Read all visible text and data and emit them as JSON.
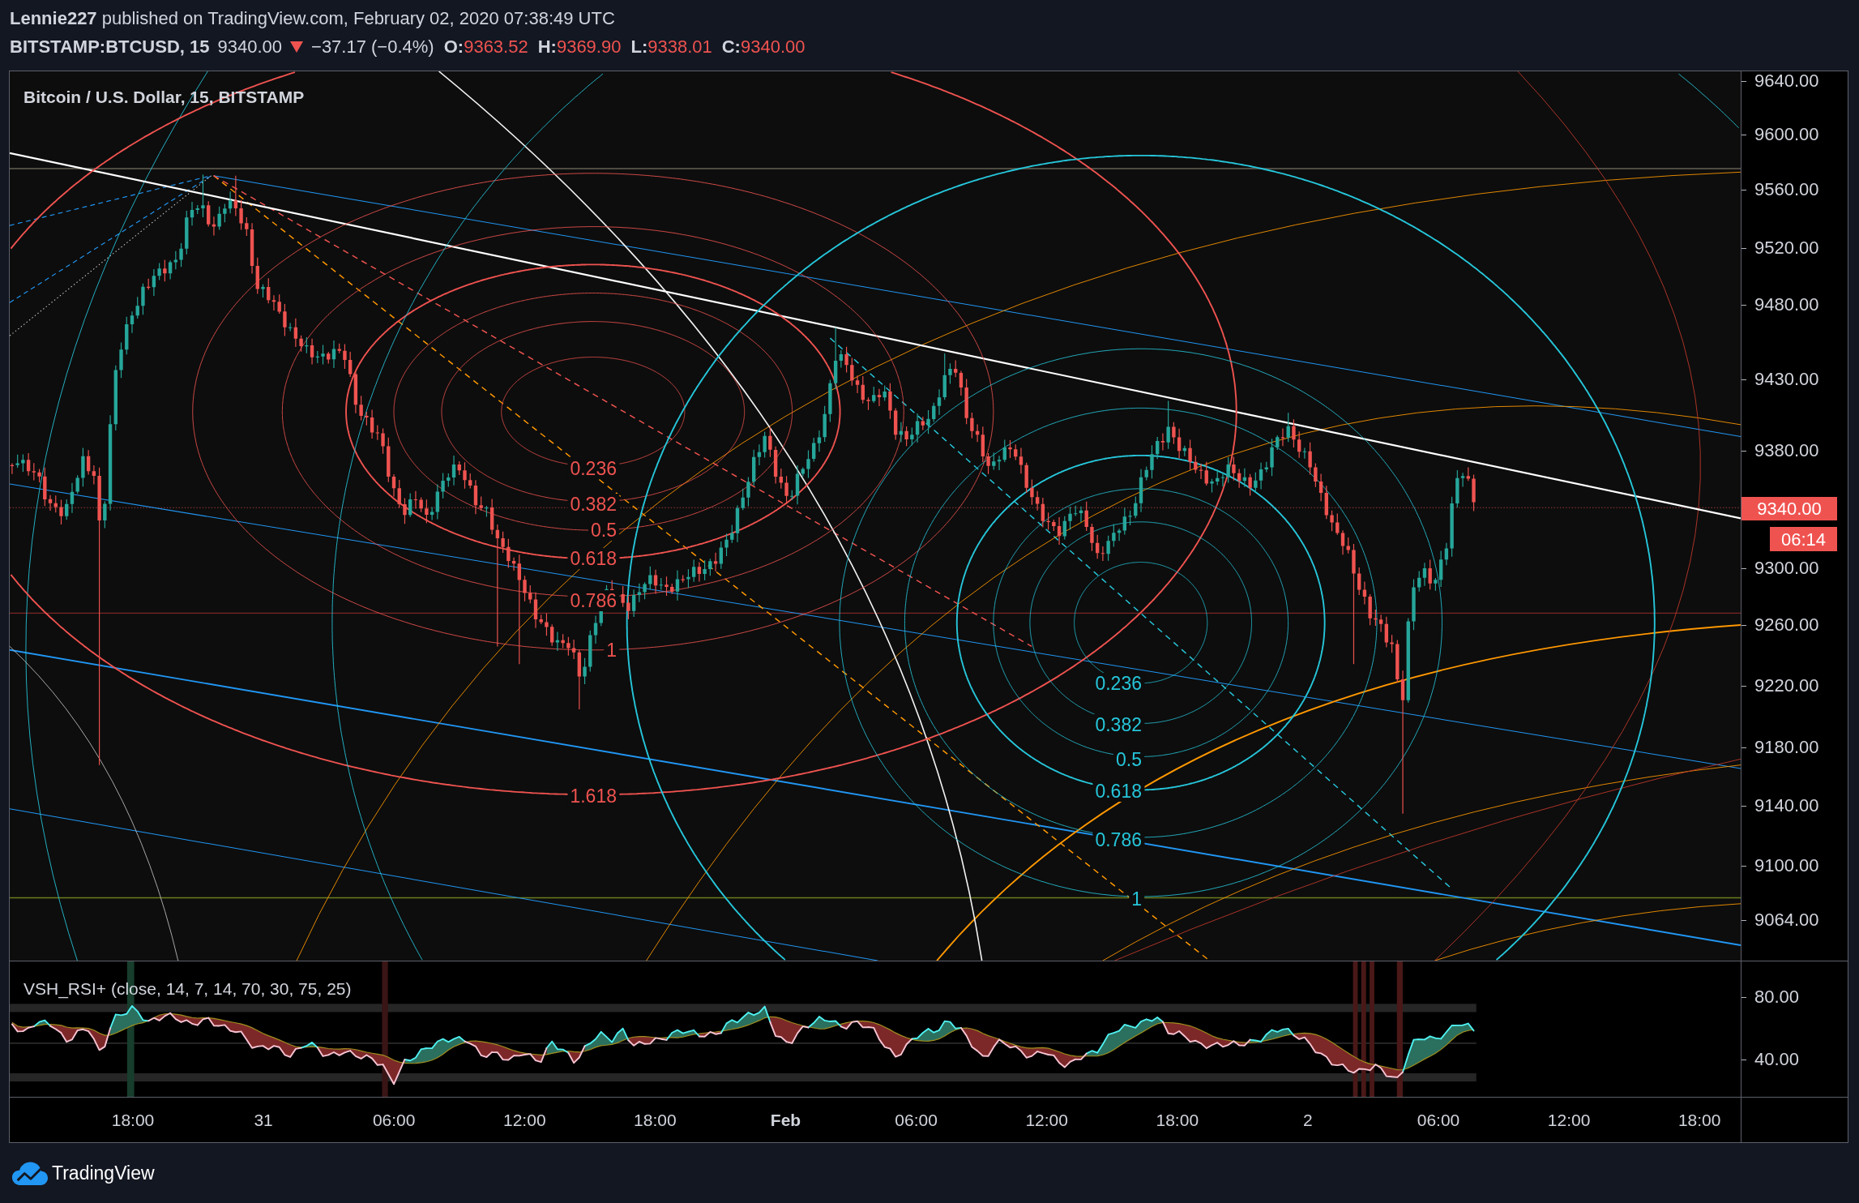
{
  "header": {
    "byline": "**Lennie227** published on TradingView.com, February 02, 2020 07:38:49 UTC"
  },
  "quote": {
    "symbol": "BITSTAMP:BTCUSD, 15",
    "last": "9340.00",
    "falling": true,
    "change": "−37.17 (−0.4%)",
    "ohlc": [
      {
        "label": "O:",
        "value": "9363.52"
      },
      {
        "label": "H:",
        "value": "9369.90"
      },
      {
        "label": "L:",
        "value": "9338.01"
      },
      {
        "label": "C:",
        "value": "9340.00"
      }
    ]
  },
  "main_pane": {
    "title": "Bitcoin / U.S. Dollar, 15, BITSTAMP",
    "price_axis": [
      "9640.00",
      "9600.00",
      "9560.00",
      "9520.00",
      "9480.00",
      "9430.00",
      "9380.00",
      "9300.00",
      "9260.00",
      "9220.00",
      "9180.00",
      "9140.00",
      "9100.00",
      "9064.00"
    ],
    "last_price_tag": "9340.00",
    "countdown": "06:14",
    "fib_circles": [
      {
        "color": "#ef5350",
        "labels": [
          "0.236",
          "0.382",
          "0.5",
          "0.618",
          "0.786",
          "1",
          "1.618"
        ]
      },
      {
        "color": "#26c6da",
        "labels": [
          "0.236",
          "0.382",
          "0.5",
          "0.618",
          "0.786",
          "1"
        ]
      }
    ]
  },
  "indicator": {
    "title": "VSH_RSI+ (close, 14, 7, 14, 70, 30, 75, 25)",
    "axis": [
      "80.00",
      "40.00"
    ]
  },
  "time_axis": [
    {
      "label": "18:00",
      "bold": false
    },
    {
      "label": "31",
      "bold": false
    },
    {
      "label": "06:00",
      "bold": false
    },
    {
      "label": "12:00",
      "bold": false
    },
    {
      "label": "18:00",
      "bold": false
    },
    {
      "label": "Feb",
      "bold": true
    },
    {
      "label": "06:00",
      "bold": false
    },
    {
      "label": "12:00",
      "bold": false
    },
    {
      "label": "18:00",
      "bold": false
    },
    {
      "label": "2",
      "bold": false
    },
    {
      "label": "06:00",
      "bold": false
    },
    {
      "label": "12:00",
      "bold": false
    },
    {
      "label": "18:00",
      "bold": false
    }
  ],
  "footer": {
    "brand": "TradingView"
  }
}
